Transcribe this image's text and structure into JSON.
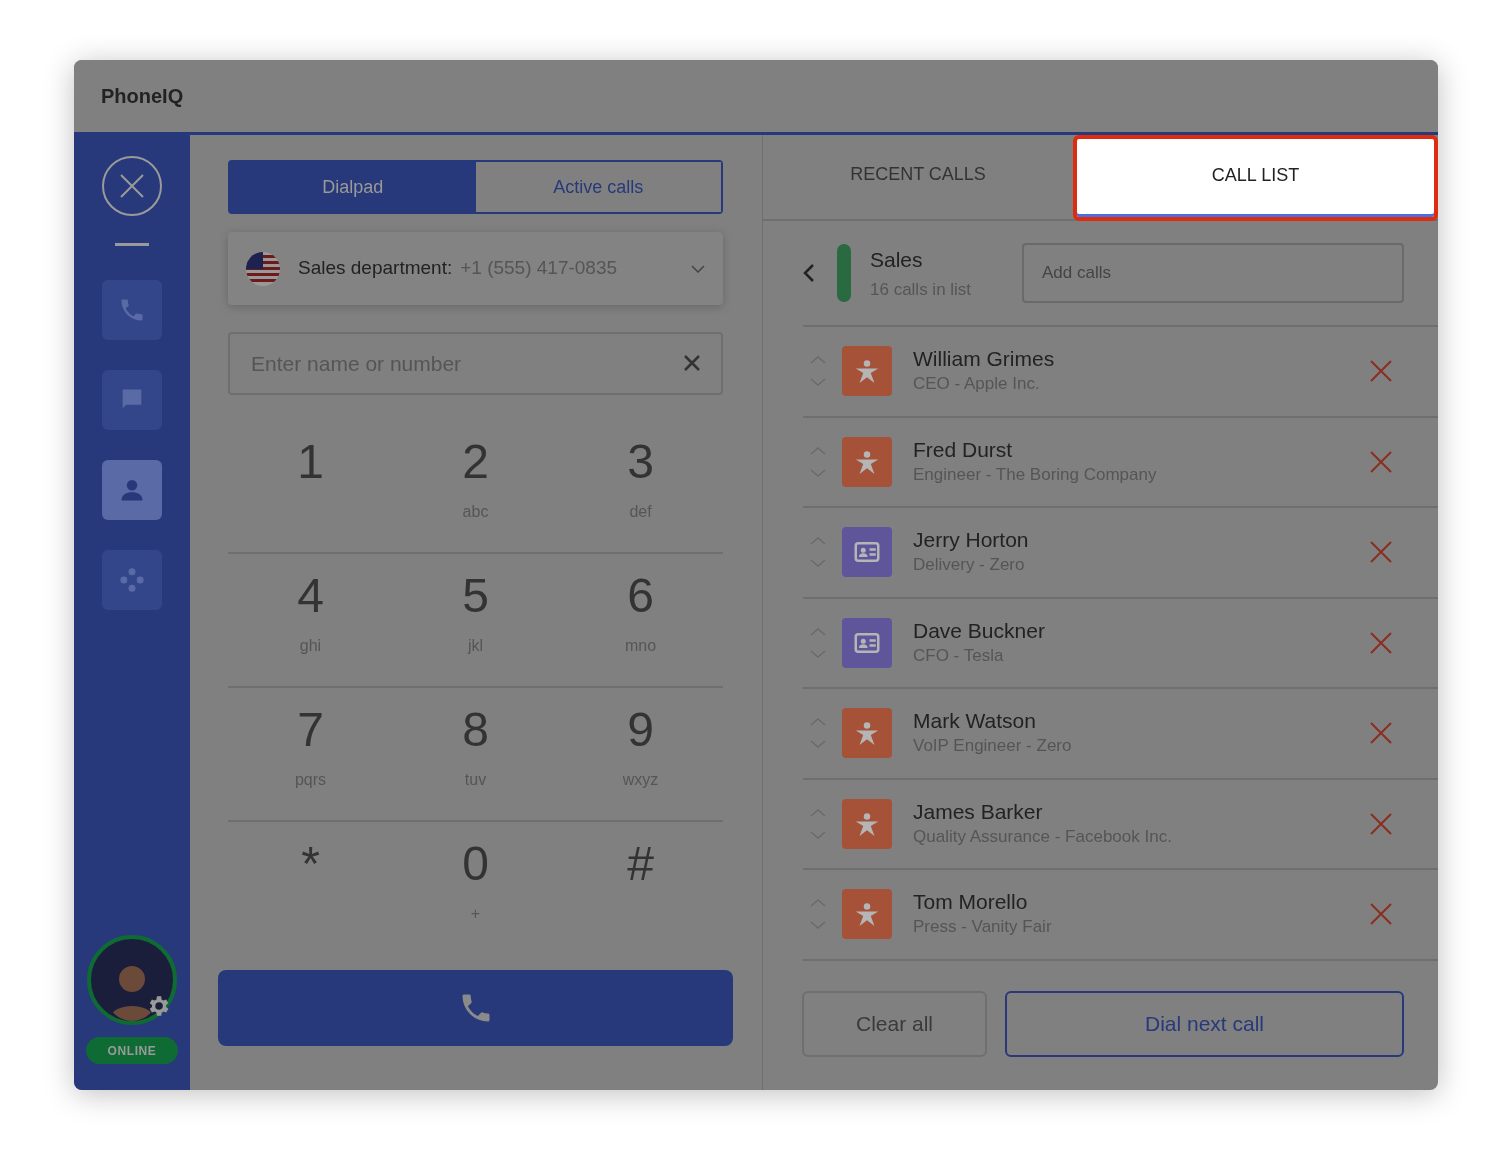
{
  "window": {
    "title": "PhoneIQ"
  },
  "sidebar": {
    "items": [
      {
        "kind": "phone",
        "selected": false
      },
      {
        "kind": "chat",
        "selected": false
      },
      {
        "kind": "person",
        "selected": true
      },
      {
        "kind": "apps",
        "selected": false
      }
    ],
    "status": "ONLINE"
  },
  "dialer": {
    "tabs": [
      {
        "label": "Dialpad",
        "selected": true
      },
      {
        "label": "Active calls",
        "selected": false
      }
    ],
    "line": {
      "label": "Sales department:",
      "number": "+1 (555) 417-0835"
    },
    "search": {
      "placeholder": "Enter name or number"
    },
    "keys": [
      {
        "digit": "1"
      },
      {
        "digit": "2",
        "letters": "abc"
      },
      {
        "digit": "3",
        "letters": "def"
      },
      {
        "digit": "4",
        "letters": "ghi"
      },
      {
        "digit": "5",
        "letters": "jkl"
      },
      {
        "digit": "6",
        "letters": "mno"
      },
      {
        "digit": "7",
        "letters": "pqrs"
      },
      {
        "digit": "8",
        "letters": "tuv"
      },
      {
        "digit": "9",
        "letters": "wxyz"
      },
      {
        "digit": "*"
      },
      {
        "digit": "0",
        "letters": "+"
      },
      {
        "digit": "#"
      }
    ]
  },
  "panel": {
    "tabs": [
      {
        "label": "RECENT CALLS",
        "selected": false
      },
      {
        "label": "CALL LIST",
        "selected": true
      }
    ],
    "list": {
      "name": "Sales",
      "count": "16 calls in list",
      "color": "#2a6a40",
      "add_placeholder": "Add calls"
    },
    "calls": [
      {
        "name": "William Grimes",
        "detail": "CEO - Apple Inc.",
        "kind": "star"
      },
      {
        "name": "Fred Durst",
        "detail": "Engineer - The Boring Company",
        "kind": "star"
      },
      {
        "name": "Jerry Horton",
        "detail": "Delivery - Zero",
        "kind": "card"
      },
      {
        "name": "Dave Buckner",
        "detail": "CFO - Tesla",
        "kind": "card"
      },
      {
        "name": "Mark Watson",
        "detail": "VoIP Engineer - Zero",
        "kind": "star"
      },
      {
        "name": "James Barker",
        "detail": "Quality Assurance - Facebook Inc.",
        "kind": "star"
      },
      {
        "name": "Tom Morello",
        "detail": "Press - Vanity Fair",
        "kind": "star"
      }
    ],
    "buttons": [
      {
        "label": "Clear all",
        "kind": "secondary"
      },
      {
        "label": "Dial next call",
        "kind": "primary"
      }
    ]
  }
}
